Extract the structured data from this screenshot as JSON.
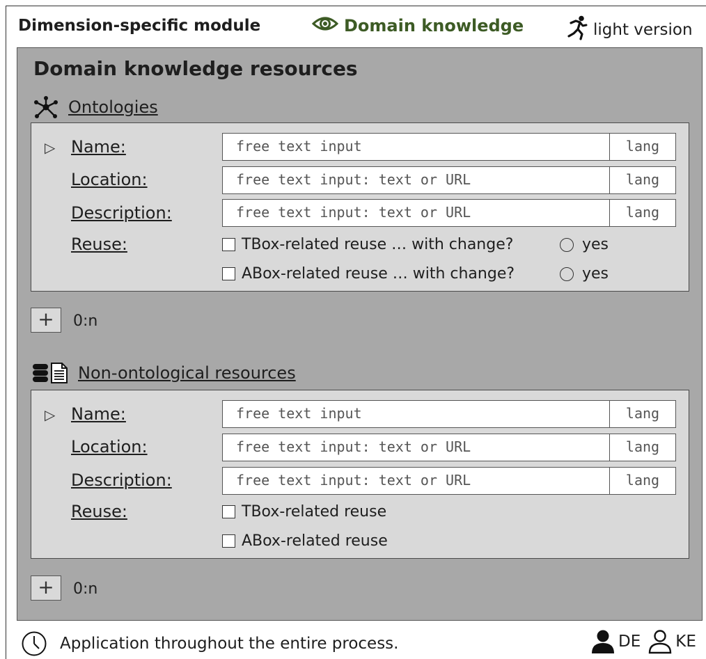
{
  "header": {
    "title": "Dimension-specific module",
    "domain_label": "Domain knowledge",
    "light_label": "light version",
    "accent_color": "#3d5b25",
    "icons": {
      "domain": "eye-icon",
      "light": "running-person-icon"
    }
  },
  "panel": {
    "title": "Domain knowledge resources"
  },
  "ontologies": {
    "heading": "Ontologies",
    "icon": "network-icon",
    "fields": [
      {
        "label": "Name:",
        "placeholder": "free text input",
        "lang": "lang"
      },
      {
        "label": "Location:",
        "placeholder": "free text input: text or URL",
        "lang": "lang"
      },
      {
        "label": "Description:",
        "placeholder": "free text input: text or URL",
        "lang": "lang"
      }
    ],
    "reuse_label": "Reuse:",
    "reuse_options": [
      {
        "text": "TBox-related reuse … with change?",
        "radio": "yes"
      },
      {
        "text": "ABox-related reuse … with change?",
        "radio": "yes"
      }
    ],
    "cardinality": "0:n"
  },
  "nonontological": {
    "heading": "Non-ontological resources",
    "icon": "database-document-icon",
    "fields": [
      {
        "label": "Name:",
        "placeholder": "free text input",
        "lang": "lang"
      },
      {
        "label": "Location:",
        "placeholder": "free text input: text or URL",
        "lang": "lang"
      },
      {
        "label": "Description:",
        "placeholder": "free text input: text or URL",
        "lang": "lang"
      }
    ],
    "reuse_label": "Reuse:",
    "reuse_options": [
      {
        "text": "TBox-related reuse"
      },
      {
        "text": "ABox-related reuse"
      }
    ],
    "cardinality": "0:n"
  },
  "footer": {
    "text": "Application throughout the entire process.",
    "role_primary": "DE",
    "role_secondary": "KE",
    "icons": {
      "time": "clock-icon",
      "primary": "person-filled-icon",
      "secondary": "person-outline-icon"
    }
  }
}
